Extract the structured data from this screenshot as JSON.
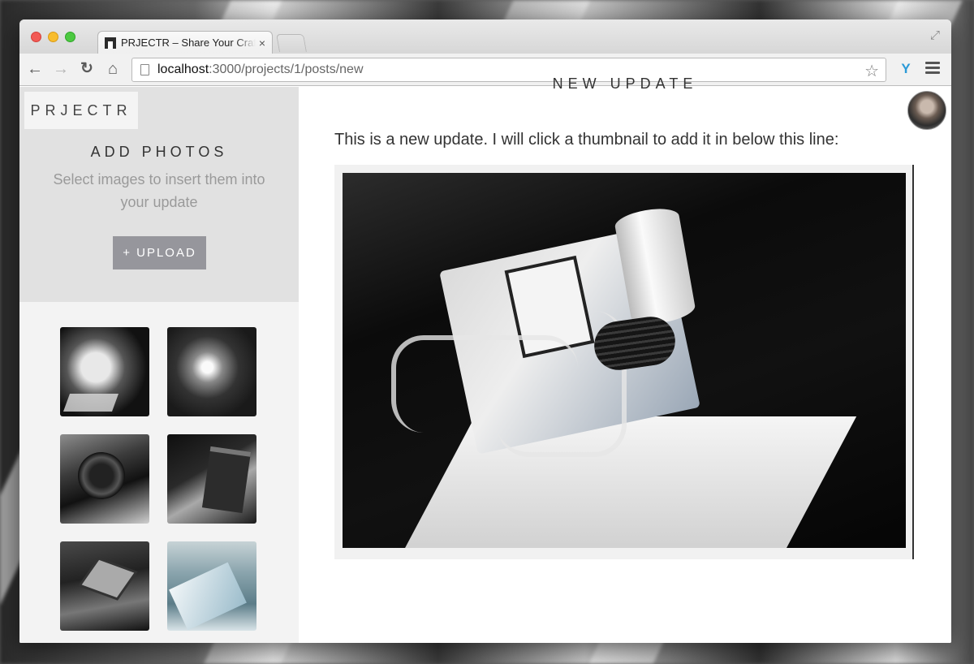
{
  "browser": {
    "tab_title": "PRJECTR – Share Your Craft",
    "tab_close": "×",
    "url_host": "localhost",
    "url_path": ":3000/projects/1/posts/new",
    "icons": {
      "back": "back-arrow-icon",
      "forward": "forward-arrow-icon",
      "reload": "reload-icon",
      "home": "home-icon",
      "star": "star-icon",
      "extension": "extension-icon",
      "menu": "hamburger-menu-icon",
      "fullscreen": "fullscreen-icon"
    }
  },
  "sidebar": {
    "logo": "PRJECTR",
    "title": "ADD PHOTOS",
    "subtitle": "Select images to insert them into your update",
    "upload_label": "+ UPLOAD",
    "thumbnails": 6
  },
  "main": {
    "heading": "NEW UPDATE",
    "body_text": "This is a new update. I will click a thumbnail to add it in below this line:"
  },
  "colors": {
    "upload_button": "#96969c",
    "sidebar_top": "#e1e1e1",
    "sidebar": "#f3f3f3"
  }
}
